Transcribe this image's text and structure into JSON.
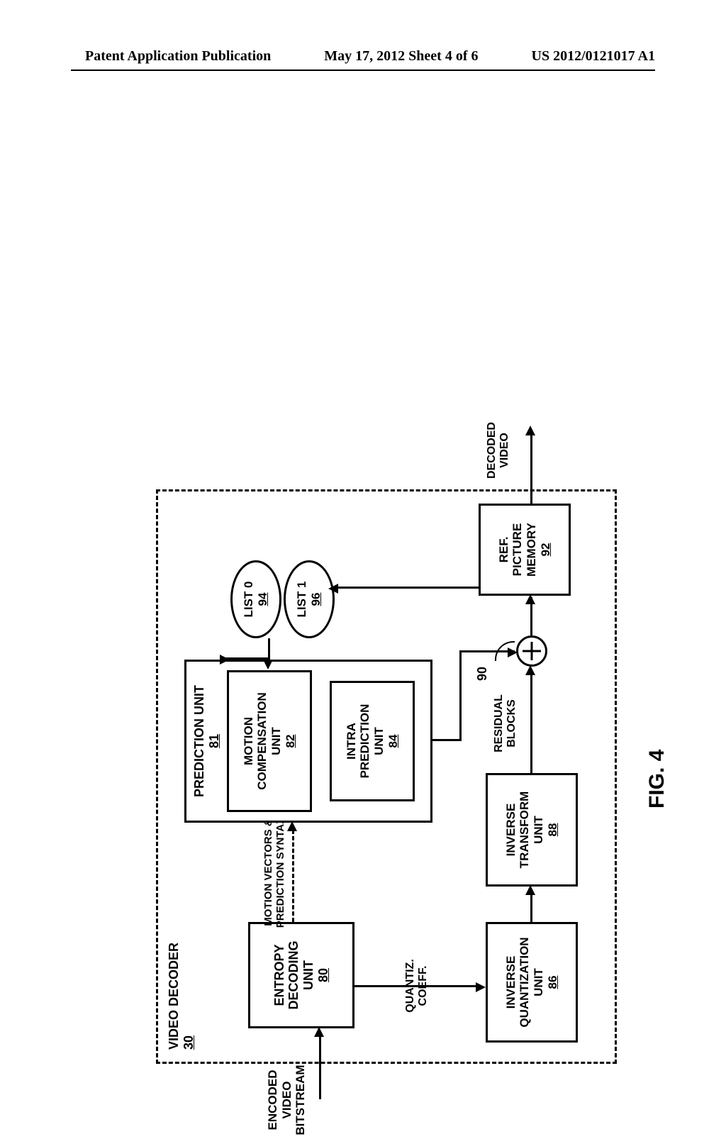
{
  "header": {
    "left": "Patent Application Publication",
    "center": "May 17, 2012  Sheet 4 of 6",
    "right": "US 2012/0121017 A1"
  },
  "figure_label": "FIG. 4",
  "outer": {
    "title": "VIDEO DECODER",
    "num": "30"
  },
  "inputs": {
    "encoded": "ENCODED\nVIDEO\nBITSTREAM",
    "decoded": "DECODED\nVIDEO"
  },
  "blocks": {
    "entropy": {
      "label": "ENTROPY\nDECODING\nUNIT",
      "num": "80"
    },
    "prediction_unit": {
      "label": "PREDICTION UNIT",
      "num": "81"
    },
    "motion_comp": {
      "label": "MOTION\nCOMPENSATION\nUNIT",
      "num": "82"
    },
    "intra": {
      "label": "INTRA\nPREDICTION\nUNIT",
      "num": "84"
    },
    "inverse_quant": {
      "label": "INVERSE\nQUANTIZATION\nUNIT",
      "num": "86"
    },
    "inverse_transform": {
      "label": "INVERSE\nTRANSFORM\nUNIT",
      "num": "88"
    },
    "ref_memory": {
      "label": "REF.\nPICTURE\nMEMORY",
      "num": "92"
    }
  },
  "lists": {
    "list0": {
      "label": "LIST 0",
      "num": "94"
    },
    "list1": {
      "label": "LIST 1",
      "num": "96"
    }
  },
  "annotations": {
    "motion_vectors": "MOTION VECTORS &\nPREDICTION SYNTAX",
    "quantiz_coeff": "QUANTIZ.\nCOEFF.",
    "residual": "RESIDUAL\nBLOCKS",
    "summer_num": "90"
  },
  "chart_data": {
    "type": "diagram",
    "title": "FIG. 4",
    "nodes": [
      {
        "id": "input",
        "label": "ENCODED VIDEO BITSTREAM",
        "type": "io"
      },
      {
        "id": "entropy",
        "label": "ENTROPY DECODING UNIT",
        "ref": "80",
        "type": "block"
      },
      {
        "id": "prediction_unit",
        "label": "PREDICTION UNIT",
        "ref": "81",
        "type": "block",
        "children": [
          "motion_comp",
          "intra"
        ]
      },
      {
        "id": "motion_comp",
        "label": "MOTION COMPENSATION UNIT",
        "ref": "82",
        "type": "block"
      },
      {
        "id": "intra",
        "label": "INTRA PREDICTION UNIT",
        "ref": "84",
        "type": "block"
      },
      {
        "id": "inverse_quant",
        "label": "INVERSE QUANTIZATION UNIT",
        "ref": "86",
        "type": "block"
      },
      {
        "id": "inverse_transform",
        "label": "INVERSE TRANSFORM UNIT",
        "ref": "88",
        "type": "block"
      },
      {
        "id": "summer",
        "label": "+",
        "ref": "90",
        "type": "summer"
      },
      {
        "id": "ref_memory",
        "label": "REF. PICTURE MEMORY",
        "ref": "92",
        "type": "block"
      },
      {
        "id": "list0",
        "label": "LIST 0",
        "ref": "94",
        "type": "list"
      },
      {
        "id": "list1",
        "label": "LIST 1",
        "ref": "96",
        "type": "list"
      },
      {
        "id": "output",
        "label": "DECODED VIDEO",
        "type": "io"
      }
    ],
    "edges": [
      {
        "from": "input",
        "to": "entropy"
      },
      {
        "from": "entropy",
        "to": "prediction_unit",
        "label": "MOTION VECTORS & PREDICTION SYNTAX",
        "style": "dashed"
      },
      {
        "from": "entropy",
        "to": "inverse_quant",
        "label": "QUANTIZ. COEFF."
      },
      {
        "from": "inverse_quant",
        "to": "inverse_transform"
      },
      {
        "from": "inverse_transform",
        "to": "summer",
        "label": "RESIDUAL BLOCKS"
      },
      {
        "from": "prediction_unit",
        "to": "summer"
      },
      {
        "from": "summer",
        "to": "ref_memory"
      },
      {
        "from": "ref_memory",
        "to": "list0"
      },
      {
        "from": "ref_memory",
        "to": "list1"
      },
      {
        "from": "list0",
        "to": "motion_comp"
      },
      {
        "from": "list1",
        "to": "motion_comp"
      },
      {
        "from": "summer",
        "to": "output"
      }
    ],
    "container": {
      "id": "video_decoder",
      "label": "VIDEO DECODER",
      "ref": "30"
    }
  }
}
